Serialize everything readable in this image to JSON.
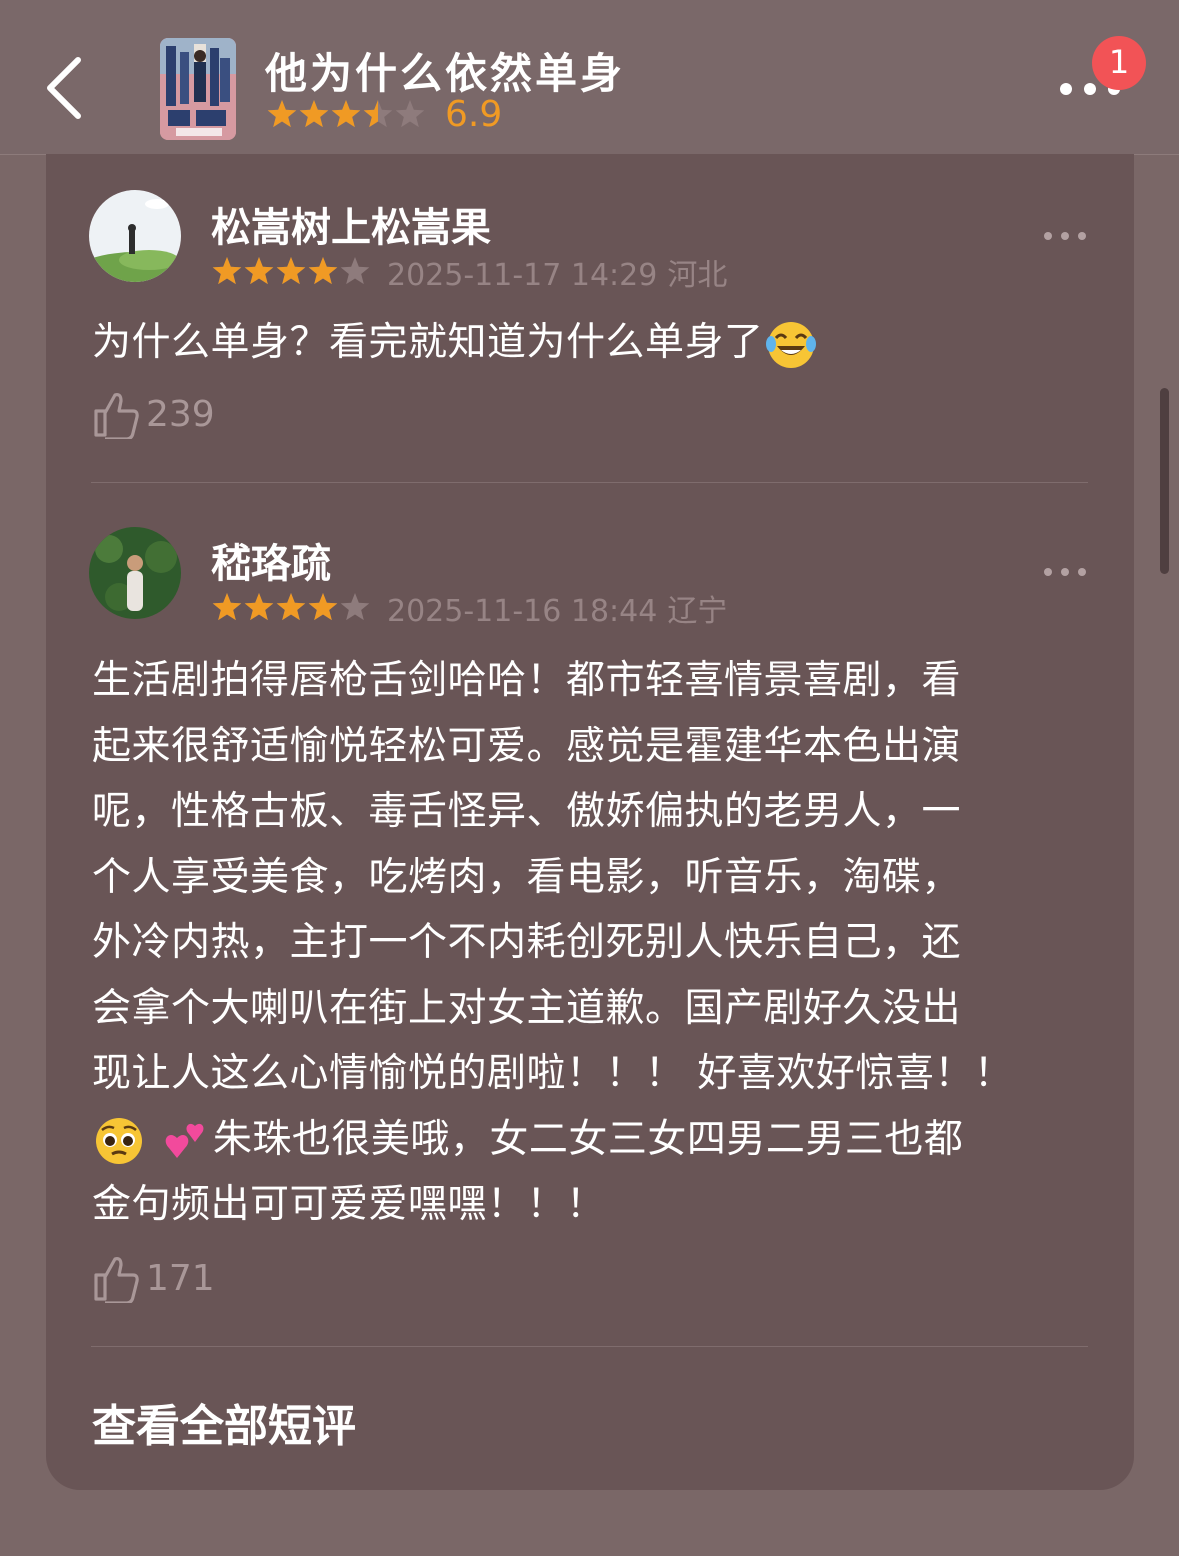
{
  "header": {
    "title": "他为什么依然单身",
    "score": "6.9",
    "rating_stars": 3.5,
    "notification_count": "1",
    "back_icon": "chevron-left-icon",
    "more_icon": "more-dots-icon"
  },
  "comments": [
    {
      "user": "松嵩树上松嵩果",
      "stars": 4,
      "date": "2025-11-17 14:29",
      "location": "河北",
      "lines": [
        "为什么单身？看完就知道为什么单身了"
      ],
      "emoji": "face-with-tears-of-joy",
      "likes": "239"
    },
    {
      "user": "嵇珞疏",
      "stars": 4,
      "date": "2025-11-16 18:44",
      "location": "辽宁",
      "lines": [
        "生活剧拍得唇枪舌剑哈哈！都市轻喜情景喜剧，看",
        "起来很舒适愉悦轻松可爱。感觉是霍建华本色出演",
        "呢，性格古板、毒舌怪异、傲娇偏执的老男人，一",
        "个人享受美食，吃烤肉，看电影，听音乐，淘碟，",
        "外冷内热，主打一个不内耗创死别人快乐自己，还",
        "会拿个大喇叭在街上对女主道歉。国产剧好久没出",
        "现让人这么心情愉悦的剧啦！！！ 好喜欢好惊喜！！",
        "朱珠也很美哦，女二女三女四男二男三也都",
        "金句频出可可爱爱嘿嘿！！！"
      ],
      "likes": "171"
    }
  ],
  "view_all_label": "查看全部短评",
  "colors": {
    "star_active": "#f09a24",
    "star_inactive": "#8e7b7c",
    "card_bg": "#695556",
    "page_bg": "#7a6767",
    "badge": "#f25356"
  }
}
